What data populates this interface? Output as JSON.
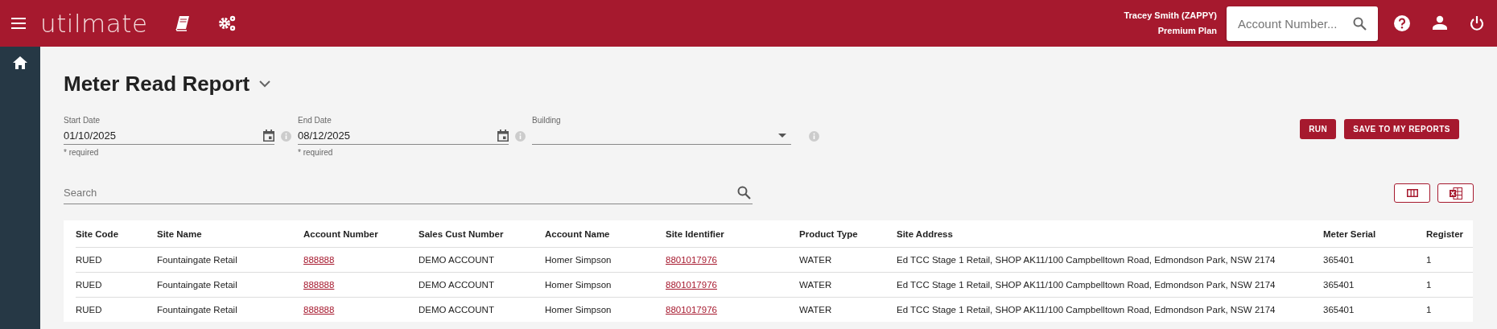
{
  "header": {
    "logo": "utilmate",
    "user_name": "Tracey Smith (ZAPPY)",
    "plan": "Premium Plan",
    "search": {
      "placeholder": "Account Number..."
    }
  },
  "page": {
    "title": "Meter Read Report"
  },
  "filters": [
    {
      "kind": "date",
      "label": "Start Date",
      "value": "01/10/2025",
      "hint": "* required"
    },
    {
      "kind": "date",
      "label": "End Date",
      "value": "08/12/2025",
      "hint": "* required"
    },
    {
      "kind": "select",
      "label": "Building"
    }
  ],
  "buttons": [
    "RUN",
    "SAVE TO MY REPORTS"
  ],
  "search": {
    "placeholder": "Search"
  },
  "table": {
    "columns": [
      {
        "label": "Site Code",
        "kind": "text"
      },
      {
        "label": "Site Name",
        "kind": "text"
      },
      {
        "label": "Account Number",
        "kind": "link"
      },
      {
        "label": "Sales Cust Number",
        "kind": "text"
      },
      {
        "label": "Account Name",
        "kind": "text"
      },
      {
        "label": "Site Identifier",
        "kind": "link"
      },
      {
        "label": "Product Type",
        "kind": "text"
      },
      {
        "label": "Site Address",
        "kind": "text"
      },
      {
        "label": "Meter Serial",
        "kind": "text"
      },
      {
        "label": "Register",
        "kind": "text"
      }
    ],
    "rows": [
      [
        "RUED",
        "Fountaingate Retail",
        "888888",
        "DEMO ACCOUNT",
        "Homer Simpson",
        "8801017976",
        "WATER",
        "Ed TCC Stage 1 Retail, SHOP AK11/100 Campbelltown Road, Edmondson Park, NSW 2174",
        "365401",
        "1"
      ],
      [
        "RUED",
        "Fountaingate Retail",
        "888888",
        "DEMO ACCOUNT",
        "Homer Simpson",
        "8801017976",
        "WATER",
        "Ed TCC Stage 1 Retail, SHOP AK11/100 Campbelltown Road, Edmondson Park, NSW 2174",
        "365401",
        "1"
      ],
      [
        "RUED",
        "Fountaingate Retail",
        "888888",
        "DEMO ACCOUNT",
        "Homer Simpson",
        "8801017976",
        "WATER",
        "Ed TCC Stage 1 Retail, SHOP AK11/100 Campbelltown Road, Edmondson Park, NSW 2174",
        "365401",
        "1"
      ]
    ]
  }
}
